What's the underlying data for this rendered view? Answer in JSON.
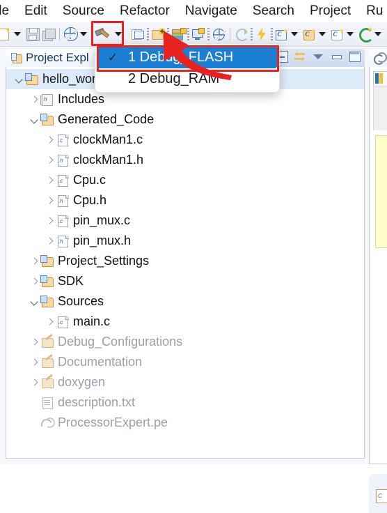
{
  "menubar": {
    "items": [
      {
        "label": "ile"
      },
      {
        "label": "Edit"
      },
      {
        "label": "Source"
      },
      {
        "label": "Refactor"
      },
      {
        "label": "Navigate"
      },
      {
        "label": "Search"
      },
      {
        "label": "Project"
      },
      {
        "label": "Ru"
      }
    ]
  },
  "toolbar": {
    "items": [
      {
        "name": "new-file-button",
        "icon": "new-file-icon",
        "has_arrow": true
      },
      {
        "name": "save-button",
        "icon": "save-icon",
        "has_arrow": false
      },
      {
        "name": "save-all-button",
        "icon": "save-all-icon",
        "has_arrow": false
      },
      {
        "name": "debug-button",
        "icon": "debug-globe-icon",
        "has_arrow": true
      },
      {
        "name": "build-button",
        "icon": "hammer-icon",
        "has_arrow": true
      },
      {
        "name": "new-page-button",
        "icon": "new-page-icon",
        "has_arrow": false
      },
      {
        "name": "new-folder-button",
        "icon": "new-folder-icon",
        "has_arrow": false
      },
      {
        "name": "new-stack-button",
        "icon": "layers-plus-icon",
        "has_arrow": false
      },
      {
        "name": "new-screen-button",
        "icon": "screen-plus-icon",
        "has_arrow": false
      },
      {
        "name": "skip-breakpoints-button",
        "icon": "skip-breakpoints-icon",
        "has_arrow": false
      },
      {
        "name": "refresh-button",
        "icon": "refresh-icon",
        "has_arrow": false
      },
      {
        "name": "run-button",
        "icon": "lightning-icon",
        "has_arrow": false
      },
      {
        "name": "new-c-project-button",
        "icon": "c-project-icon",
        "has_arrow": true
      },
      {
        "name": "new-c-folder-button",
        "icon": "c-folder-icon",
        "has_arrow": true
      },
      {
        "name": "new-c-file-button",
        "icon": "c-file-icon",
        "has_arrow": true
      },
      {
        "name": "new-target-button",
        "icon": "target-icon",
        "has_arrow": true
      }
    ]
  },
  "project_explorer": {
    "tab_label": "Project Expl",
    "tab_icon": "project-explorer-icon",
    "view_tools": [
      {
        "name": "collapse-all-button",
        "icon": "collapse-all-icon"
      },
      {
        "name": "link-with-editor-button",
        "icon": "link-editor-icon"
      },
      {
        "name": "view-menu-button",
        "icon": "chevron-down-icon"
      },
      {
        "name": "minimize-view-button",
        "icon": "minimize-icon"
      },
      {
        "name": "maximize-view-button",
        "icon": "maximize-icon"
      }
    ],
    "tree": [
      {
        "label": "hello_wor",
        "indent": 0,
        "twisty": "open",
        "icon": "project-folder-icon",
        "dim": false,
        "selected": true
      },
      {
        "label": "Includes",
        "indent": 1,
        "twisty": "closed",
        "icon": "includes-icon",
        "dim": false,
        "selected": false
      },
      {
        "label": "Generated_Code",
        "indent": 1,
        "twisty": "open",
        "icon": "source-folder-icon",
        "dim": false,
        "selected": false
      },
      {
        "label": "clockMan1.c",
        "indent": 2,
        "twisty": "closed",
        "icon": "c-file-icon",
        "dim": false,
        "selected": false
      },
      {
        "label": "clockMan1.h",
        "indent": 2,
        "twisty": "closed",
        "icon": "h-file-icon",
        "dim": false,
        "selected": false
      },
      {
        "label": "Cpu.c",
        "indent": 2,
        "twisty": "closed",
        "icon": "c-file-icon",
        "dim": false,
        "selected": false
      },
      {
        "label": "Cpu.h",
        "indent": 2,
        "twisty": "closed",
        "icon": "h-file-icon",
        "dim": false,
        "selected": false
      },
      {
        "label": "pin_mux.c",
        "indent": 2,
        "twisty": "closed",
        "icon": "c-file-icon",
        "dim": false,
        "selected": false
      },
      {
        "label": "pin_mux.h",
        "indent": 2,
        "twisty": "closed",
        "icon": "h-file-icon",
        "dim": false,
        "selected": false
      },
      {
        "label": "Project_Settings",
        "indent": 1,
        "twisty": "closed",
        "icon": "source-folder-icon",
        "dim": false,
        "selected": false
      },
      {
        "label": "SDK",
        "indent": 1,
        "twisty": "closed",
        "icon": "source-folder-icon",
        "dim": false,
        "selected": false
      },
      {
        "label": "Sources",
        "indent": 1,
        "twisty": "open",
        "icon": "source-folder-icon",
        "dim": false,
        "selected": false
      },
      {
        "label": "main.c",
        "indent": 2,
        "twisty": "closed",
        "icon": "c-file-icon",
        "dim": false,
        "selected": false
      },
      {
        "label": "Debug_Configurations",
        "indent": 1,
        "twisty": "closed",
        "icon": "dim-folder-icon",
        "dim": true,
        "selected": false
      },
      {
        "label": "Documentation",
        "indent": 1,
        "twisty": "closed",
        "icon": "dim-folder-icon",
        "dim": true,
        "selected": false
      },
      {
        "label": "doxygen",
        "indent": 1,
        "twisty": "closed",
        "icon": "dim-folder-icon",
        "dim": true,
        "selected": false
      },
      {
        "label": "description.txt",
        "indent": 1,
        "twisty": "none",
        "icon": "text-file-icon",
        "dim": true,
        "selected": false
      },
      {
        "label": "ProcessorExpert.pe",
        "indent": 1,
        "twisty": "none",
        "icon": "processor-expert-icon",
        "dim": true,
        "selected": false
      }
    ]
  },
  "build_config_menu": {
    "items": [
      {
        "label": "1 Debug_FLASH",
        "checked": true,
        "check_glyph": "✓",
        "highlighted": true
      },
      {
        "label": "2 Debug_RAM",
        "checked": false,
        "check_glyph": "",
        "highlighted": false
      }
    ]
  },
  "annotations": {
    "highlight_color": "#e8231f",
    "boxes": [
      {
        "name": "build-button-highlight"
      },
      {
        "name": "debug-flash-menu-item-highlight"
      }
    ],
    "arrow": {
      "name": "pointer-arrow"
    }
  },
  "colors": {
    "menu_highlight": "#1a7fd4",
    "tree_selection": "#ddeaf8",
    "annotation_red": "#e8231f",
    "toolbar_bg": "#eceef6"
  }
}
